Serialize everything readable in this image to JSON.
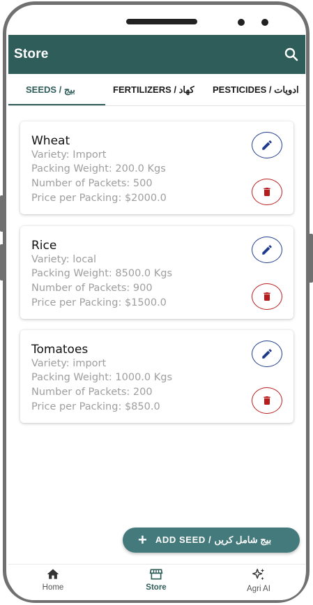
{
  "app": {
    "title": "Store"
  },
  "tabs": [
    {
      "label": "SEEDS / بیج",
      "active": true
    },
    {
      "label": "FERTILIZERS / کھاد",
      "active": false
    },
    {
      "label": "PESTICIDES / ادویات",
      "active": false
    }
  ],
  "items": [
    {
      "name": "Wheat",
      "variety": "Variety: Import",
      "weight": "Packing Weight: 200.0 Kgs",
      "packets": "Number of Packets: 500",
      "price": "Price per Packing: $2000.0"
    },
    {
      "name": "Rice",
      "variety": "Variety: local",
      "weight": "Packing Weight: 8500.0 Kgs",
      "packets": "Number of Packets: 900",
      "price": "Price per Packing: $1500.0"
    },
    {
      "name": "Tomatoes",
      "variety": "Variety: import",
      "weight": "Packing Weight: 1000.0 Kgs",
      "packets": "Number of Packets: 200",
      "price": "Price per Packing: $850.0"
    }
  ],
  "fab": {
    "icon": "plus-icon",
    "label": "ADD SEED / بیج شامل کریں"
  },
  "bottom_nav": [
    {
      "label": "Home",
      "icon": "home-icon",
      "active": false
    },
    {
      "label": "Store",
      "icon": "store-icon",
      "active": true
    },
    {
      "label": "Agri AI",
      "icon": "sparkles-icon",
      "active": false
    }
  ],
  "colors": {
    "primary": "#2e5d5a",
    "fab": "#457a7c",
    "edit": "#1e3a8a",
    "delete": "#b71c1c"
  }
}
